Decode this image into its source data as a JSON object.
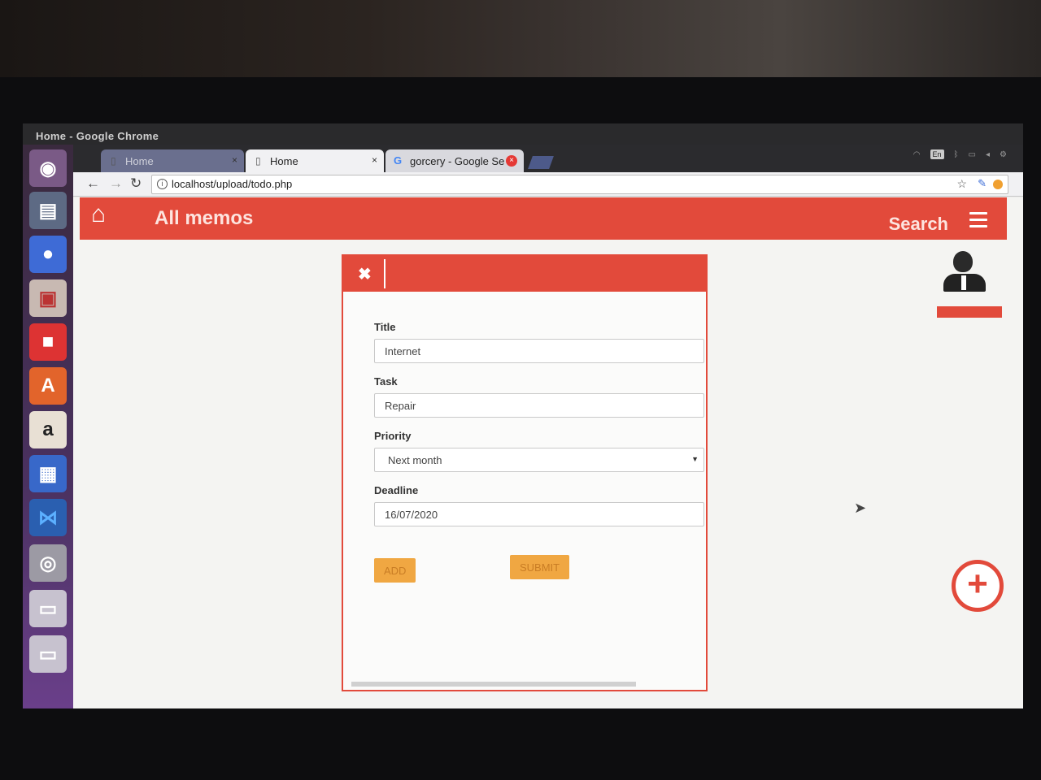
{
  "window": {
    "title": "Home - Google Chrome"
  },
  "tabs": [
    {
      "label": "Home",
      "close": "×"
    },
    {
      "label": "Home",
      "close": "×"
    },
    {
      "label": "gorcery - Google Se",
      "close": "×"
    }
  ],
  "toolbar": {
    "url": "localhost/upload/todo.php"
  },
  "tray": {
    "lang": "En"
  },
  "header": {
    "title": "All memos",
    "search": "Search"
  },
  "modal": {
    "close": "✖",
    "fields": {
      "title_label": "Title",
      "title_value": "Internet",
      "task_label": "Task",
      "task_value": "Repair",
      "priority_label": "Priority",
      "priority_value": "Next month",
      "deadline_label": "Deadline",
      "deadline_value": "16/07/2020"
    },
    "add_label": "ADD",
    "submit_label": "SUBMIT"
  },
  "fab": {
    "label": "+"
  },
  "colors": {
    "accent": "#e24a3b",
    "button": "#f0a742"
  }
}
